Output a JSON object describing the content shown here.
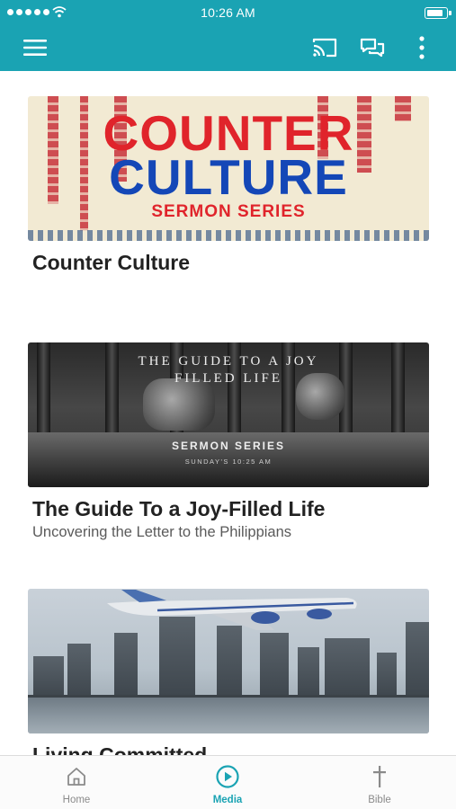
{
  "status_bar": {
    "time": "10:26 AM"
  },
  "app_bar": {
    "icons": [
      "menu-icon",
      "cast-icon",
      "chat-icon",
      "more-vertical-icon"
    ],
    "background": "#1aa3b3"
  },
  "media": {
    "items": [
      {
        "title": "Counter Culture",
        "subtitle": "",
        "art": {
          "line1": "COUNTER",
          "line2": "CULTURE",
          "line3": "SERMON SERIES"
        }
      },
      {
        "title": "The Guide To a Joy-Filled Life",
        "subtitle": "Uncovering  the Letter to the Philippians",
        "art": {
          "line1": "THE GUIDE TO A JOY",
          "line2": "FILLED LIFE",
          "line3": "SERMON SERIES",
          "line4": "SUNDAY'S 10:25 AM"
        }
      },
      {
        "title": "Living Committed",
        "subtitle": ""
      }
    ]
  },
  "tab_bar": {
    "tabs": [
      {
        "label": "Home",
        "icon": "home-icon",
        "active": false
      },
      {
        "label": "Media",
        "icon": "play-circle-icon",
        "active": true
      },
      {
        "label": "Bible",
        "icon": "cross-icon",
        "active": false
      }
    ],
    "active_color": "#1aa3b3",
    "inactive_color": "#8a8a8a"
  }
}
